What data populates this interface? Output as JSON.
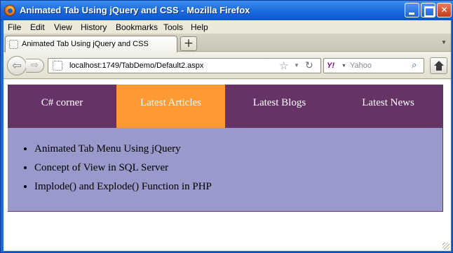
{
  "window": {
    "title": "Animated Tab Using jQuery and CSS - Mozilla Firefox"
  },
  "menubar": {
    "items": [
      "File",
      "Edit",
      "View",
      "History",
      "Bookmarks",
      "Tools",
      "Help"
    ]
  },
  "browser_tabs": {
    "active_title": "Animated Tab Using jQuery and CSS",
    "new_tab_label": "+"
  },
  "navigation": {
    "url": "localhost:1749/TabDemo/Default2.aspx",
    "search_engine": "Yahoo",
    "search_placeholder": "Yahoo"
  },
  "page": {
    "tabs": [
      {
        "label": "C# corner",
        "active": false
      },
      {
        "label": "Latest Articles",
        "active": true
      },
      {
        "label": "Latest Blogs",
        "active": false
      },
      {
        "label": "Latest News",
        "active": false
      }
    ],
    "articles": [
      "Animated Tab Menu Using jQuery",
      "Concept of View in SQL Server",
      "Implode() and Explode() Function in PHP"
    ]
  },
  "colors": {
    "tab_bar": "#663366",
    "active_tab": "#ff9933",
    "panel": "#9999cc",
    "titlebar": "#1f6fe0"
  }
}
